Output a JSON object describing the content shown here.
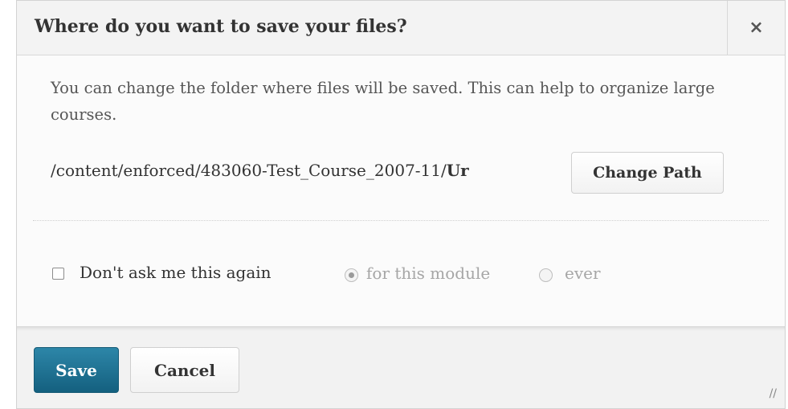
{
  "dialog": {
    "title": "Where do you want to save your files?",
    "close_label": "×"
  },
  "content": {
    "description": "You can change the folder where files will be saved. This can help to organize large courses.",
    "path_prefix": "/content/enforced/483060-Test_Course_2007-11/",
    "path_suffix": "Ur",
    "change_path_label": "Change Path"
  },
  "options": {
    "dont_ask_label": "Don't ask me this again",
    "dont_ask_checked": false,
    "scope_options": [
      {
        "label": "for this module",
        "selected": true
      },
      {
        "label": "ever",
        "selected": false
      }
    ]
  },
  "footer": {
    "save_label": "Save",
    "cancel_label": "Cancel",
    "resize_glyph": "//"
  },
  "colors": {
    "primary_button": "#1f7395",
    "muted_text": "#a6a6a6"
  }
}
